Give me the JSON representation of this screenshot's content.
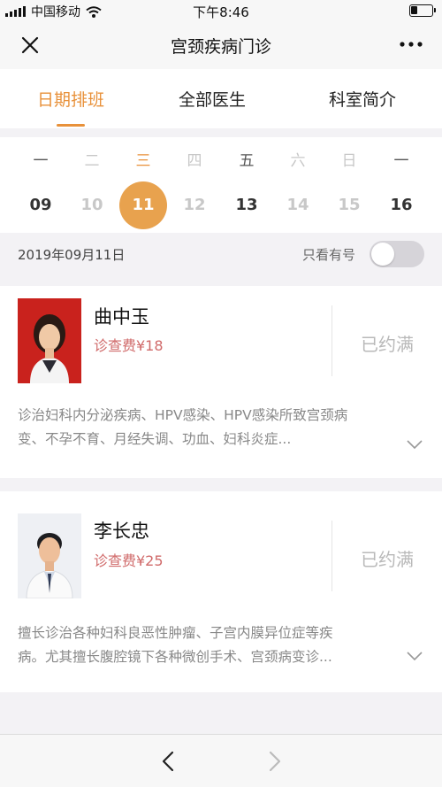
{
  "status_bar": {
    "carrier": "中国移动",
    "time": "下午8:46",
    "signal_icon": "signal-bars-icon",
    "wifi_icon": "wifi-icon",
    "battery_level": 0.3
  },
  "nav": {
    "title": "宫颈疾病门诊",
    "close_icon": "close-icon",
    "more_icon": "more-dots-icon"
  },
  "tabs": [
    {
      "label": "日期排班",
      "active": true
    },
    {
      "label": "全部医生",
      "active": false
    },
    {
      "label": "科室简介",
      "active": false
    }
  ],
  "calendar": {
    "days": [
      {
        "weekday": "一",
        "date": "09",
        "state": "available"
      },
      {
        "weekday": "二",
        "date": "10",
        "state": "disabled"
      },
      {
        "weekday": "三",
        "date": "11",
        "state": "selected"
      },
      {
        "weekday": "四",
        "date": "12",
        "state": "disabled"
      },
      {
        "weekday": "五",
        "date": "13",
        "state": "available"
      },
      {
        "weekday": "六",
        "date": "14",
        "state": "disabled"
      },
      {
        "weekday": "日",
        "date": "15",
        "state": "disabled"
      },
      {
        "weekday": "一",
        "date": "16",
        "state": "available"
      }
    ]
  },
  "filter": {
    "date": "2019年09月11日",
    "only_available_label": "只看有号",
    "only_available_on": false
  },
  "doctors": [
    {
      "name": "曲中玉",
      "fee": "诊查费¥18",
      "status": "已约满",
      "desc_line1": "诊治妇科内分泌疾病、HPV感染、HPV感染所致宫颈病",
      "desc_line2": "变、不孕不育、月经失调、功血、妇科炎症...",
      "avatar_bg": "#c9221d"
    },
    {
      "name": "李长忠",
      "fee": "诊查费¥25",
      "status": "已约满",
      "desc_line1": "擅长诊治各种妇科良恶性肿瘤、子宫内膜异位症等疾",
      "desc_line2": "病。尤其擅长腹腔镜下各种微创手术、宫颈病变诊...",
      "avatar_bg": "#eef0f4"
    }
  ],
  "bottom_bar": {
    "back_icon": "chevron-left-icon",
    "forward_icon": "chevron-right-icon"
  },
  "colors": {
    "accent": "#e8913a",
    "selected_date_bg": "#e8a24e",
    "fee_color": "#d06a6a",
    "disabled_text": "#c8c8c8"
  }
}
